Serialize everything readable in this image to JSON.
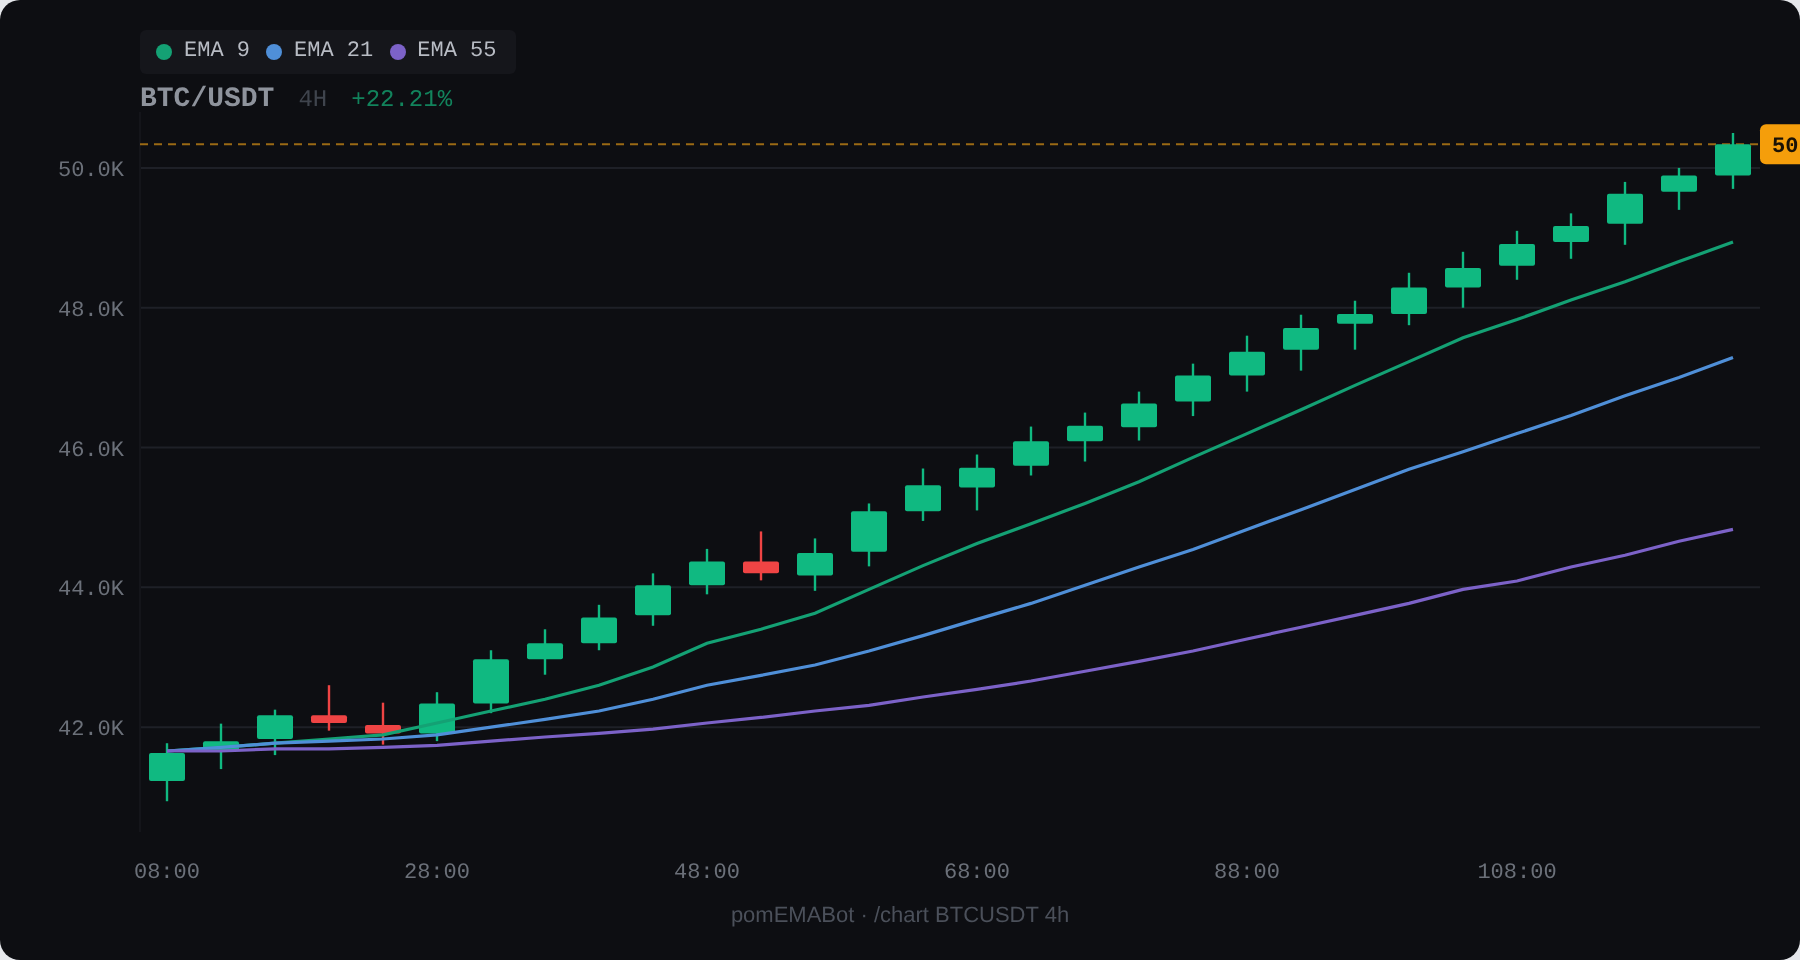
{
  "header": {
    "timeframe": "4H",
    "change": "+22.21%"
  },
  "chart": {
    "chart_data": {
      "type": "line",
      "grid": true,
      "x": [
        8,
        12,
        16,
        20,
        24,
        28,
        32,
        36,
        40,
        44,
        48,
        52,
        56,
        60,
        64,
        68,
        72,
        76,
        80,
        84,
        88,
        92,
        96,
        100,
        104,
        108,
        112,
        116,
        120,
        124
      ],
      "xlim": [
        6,
        126
      ],
      "ylim": [
        40.5,
        50.8
      ],
      "ref_lines": [
        {
          "axis": "y",
          "value": 50.34,
          "color": "#9a6a14",
          "label": "50"
        }
      ],
      "xticks": [
        {
          "value": 8,
          "label": "08:00"
        },
        {
          "value": 28,
          "label": "28:00"
        },
        {
          "value": 48,
          "label": "48:00"
        },
        {
          "value": 68,
          "label": "68:00"
        },
        {
          "value": 88,
          "label": "88:00"
        },
        {
          "value": 108,
          "label": "108:00"
        }
      ],
      "yticks": [
        {
          "value": 42,
          "label": "42.0K"
        },
        {
          "value": 44,
          "label": "44.0K"
        },
        {
          "value": 46,
          "label": "46.0K"
        },
        {
          "value": 48,
          "label": "48.0K"
        },
        {
          "value": 50,
          "label": "50.0K"
        }
      ],
      "series": [
        {
          "name": "BTC/USDT",
          "type": "candlestick",
          "ohlc": [
            [
              41.23,
              41.77,
              40.94,
              41.63
            ],
            [
              41.66,
              42.05,
              41.4,
              41.8
            ],
            [
              41.83,
              42.25,
              41.6,
              42.17
            ],
            [
              42.17,
              42.6,
              41.95,
              42.06
            ],
            [
              42.03,
              42.35,
              41.75,
              41.91
            ],
            [
              41.91,
              42.5,
              41.8,
              42.34
            ],
            [
              42.34,
              43.1,
              42.2,
              42.97
            ],
            [
              42.97,
              43.4,
              42.75,
              43.2
            ],
            [
              43.2,
              43.75,
              43.1,
              43.57
            ],
            [
              43.6,
              44.2,
              43.45,
              44.03
            ],
            [
              44.03,
              44.55,
              43.9,
              44.37
            ],
            [
              44.37,
              44.8,
              44.1,
              44.2
            ],
            [
              44.17,
              44.7,
              43.95,
              44.49
            ],
            [
              44.51,
              45.2,
              44.3,
              45.09
            ],
            [
              45.09,
              45.7,
              44.95,
              45.46
            ],
            [
              45.43,
              45.9,
              45.1,
              45.71
            ],
            [
              45.74,
              46.3,
              45.6,
              46.09
            ],
            [
              46.09,
              46.5,
              45.8,
              46.31
            ],
            [
              46.29,
              46.8,
              46.1,
              46.63
            ],
            [
              46.66,
              47.2,
              46.45,
              47.03
            ],
            [
              47.03,
              47.6,
              46.8,
              47.37
            ],
            [
              47.4,
              47.9,
              47.1,
              47.71
            ],
            [
              47.77,
              48.1,
              47.4,
              47.91
            ],
            [
              47.91,
              48.5,
              47.75,
              48.29
            ],
            [
              48.29,
              48.8,
              48.0,
              48.57
            ],
            [
              48.6,
              49.1,
              48.4,
              48.91
            ],
            [
              48.94,
              49.35,
              48.7,
              49.17
            ],
            [
              49.2,
              49.8,
              48.9,
              49.63
            ],
            [
              49.66,
              50.0,
              49.4,
              49.89
            ],
            [
              49.89,
              50.5,
              49.7,
              50.34
            ]
          ]
        },
        {
          "name": "EMA 9",
          "color": "#14a174",
          "values": [
            41.66,
            41.71,
            41.77,
            41.83,
            41.89,
            42.06,
            42.23,
            42.4,
            42.6,
            42.86,
            43.2,
            43.4,
            43.63,
            43.97,
            44.31,
            44.63,
            44.91,
            45.2,
            45.51,
            45.86,
            46.2,
            46.54,
            46.89,
            47.23,
            47.57,
            47.83,
            48.11,
            48.37,
            48.66,
            48.94
          ]
        },
        {
          "name": "EMA 21",
          "color": "#4f8fd8",
          "values": [
            41.66,
            41.71,
            41.77,
            41.8,
            41.83,
            41.89,
            42.0,
            42.11,
            42.23,
            42.4,
            42.6,
            42.74,
            42.89,
            43.09,
            43.31,
            43.54,
            43.77,
            44.03,
            44.29,
            44.54,
            44.83,
            45.11,
            45.4,
            45.69,
            45.94,
            46.2,
            46.46,
            46.74,
            47.0,
            47.29
          ]
        },
        {
          "name": "EMA 55",
          "color": "#7c62c8",
          "values": [
            41.66,
            41.66,
            41.69,
            41.69,
            41.71,
            41.74,
            41.8,
            41.86,
            41.91,
            41.97,
            42.06,
            42.14,
            42.23,
            42.31,
            42.43,
            42.54,
            42.66,
            42.8,
            42.94,
            43.09,
            43.26,
            43.43,
            43.6,
            43.77,
            43.97,
            44.09,
            44.29,
            44.46,
            44.66,
            44.83
          ]
        }
      ]
    }
  },
  "footer": "pomEMABot · /chart BTCUSDT 4h"
}
